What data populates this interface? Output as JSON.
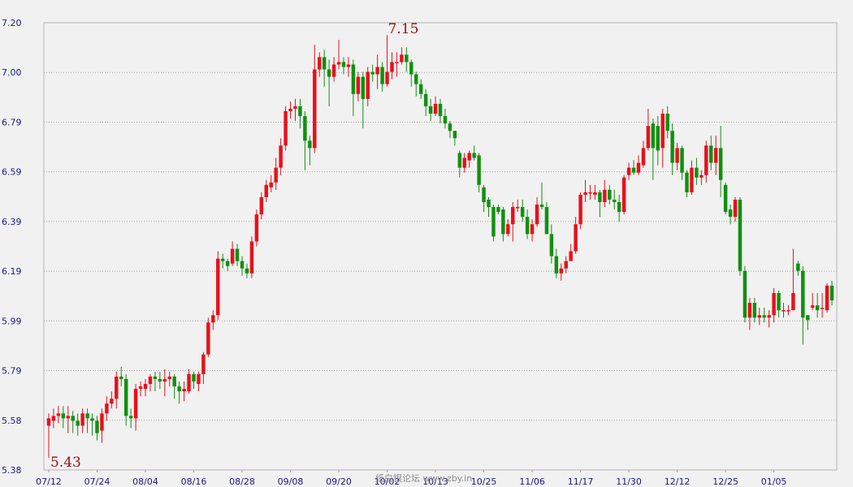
{
  "chart_data": {
    "type": "candlestick",
    "title": "",
    "xlabel": "",
    "ylabel": "",
    "ylim": [
      5.38,
      7.2
    ],
    "grid": true,
    "colors": {
      "up": "#e8101a",
      "down": "#119010",
      "grid": "#a8a8a8",
      "axis_text": "#1a1a80",
      "annotation": "#a01010"
    },
    "y_ticks": [
      "7.20",
      "7.00",
      "6.79",
      "6.59",
      "6.39",
      "6.19",
      "5.99",
      "5.79",
      "5.58",
      "5.38"
    ],
    "x_tick_labels": [
      {
        "label": "07/12",
        "index": 0
      },
      {
        "label": "07/24",
        "index": 10
      },
      {
        "label": "08/04",
        "index": 20
      },
      {
        "label": "08/16",
        "index": 30
      },
      {
        "label": "08/28",
        "index": 40
      },
      {
        "label": "09/08",
        "index": 50
      },
      {
        "label": "09/20",
        "index": 60
      },
      {
        "label": "10/02",
        "index": 70
      },
      {
        "label": "10/13",
        "index": 80
      },
      {
        "label": "10/25",
        "index": 90
      },
      {
        "label": "11/06",
        "index": 100
      },
      {
        "label": "11/17",
        "index": 110
      },
      {
        "label": "11/30",
        "index": 120
      },
      {
        "label": "12/12",
        "index": 130
      },
      {
        "label": "12/25",
        "index": 140
      },
      {
        "label": "01/05",
        "index": 150
      }
    ],
    "annotations": [
      {
        "text": "7.15",
        "index": 70,
        "value": 7.15,
        "kind": "max"
      },
      {
        "text": "5.43",
        "index": 0,
        "value": 5.43,
        "kind": "min"
      }
    ],
    "candles": [
      [
        5.56,
        5.59,
        5.61,
        5.43
      ],
      [
        5.58,
        5.6,
        5.63,
        5.55
      ],
      [
        5.6,
        5.61,
        5.64,
        5.57
      ],
      [
        5.61,
        5.59,
        5.64,
        5.55
      ],
      [
        5.59,
        5.6,
        5.64,
        5.53
      ],
      [
        5.6,
        5.58,
        5.62,
        5.53
      ],
      [
        5.58,
        5.56,
        5.61,
        5.52
      ],
      [
        5.56,
        5.61,
        5.63,
        5.53
      ],
      [
        5.61,
        5.59,
        5.63,
        5.53
      ],
      [
        5.59,
        5.58,
        5.61,
        5.52
      ],
      [
        5.58,
        5.53,
        5.6,
        5.5
      ],
      [
        5.54,
        5.61,
        5.63,
        5.49
      ],
      [
        5.61,
        5.65,
        5.68,
        5.58
      ],
      [
        5.65,
        5.67,
        5.7,
        5.63
      ],
      [
        5.67,
        5.76,
        5.78,
        5.63
      ],
      [
        5.76,
        5.75,
        5.8,
        5.72
      ],
      [
        5.75,
        5.6,
        5.77,
        5.56
      ],
      [
        5.6,
        5.59,
        5.63,
        5.55
      ],
      [
        5.59,
        5.71,
        5.73,
        5.54
      ],
      [
        5.71,
        5.72,
        5.74,
        5.68
      ],
      [
        5.71,
        5.73,
        5.75,
        5.68
      ],
      [
        5.73,
        5.76,
        5.77,
        5.7
      ],
      [
        5.76,
        5.75,
        5.78,
        5.7
      ],
      [
        5.75,
        5.74,
        5.78,
        5.71
      ],
      [
        5.74,
        5.75,
        5.79,
        5.68
      ],
      [
        5.75,
        5.76,
        5.78,
        5.72
      ],
      [
        5.76,
        5.72,
        5.77,
        5.67
      ],
      [
        5.72,
        5.7,
        5.74,
        5.65
      ],
      [
        5.7,
        5.71,
        5.74,
        5.66
      ],
      [
        5.7,
        5.77,
        5.79,
        5.69
      ],
      [
        5.77,
        5.74,
        5.78,
        5.71
      ],
      [
        5.73,
        5.77,
        5.78,
        5.7
      ],
      [
        5.77,
        5.85,
        5.86,
        5.73
      ],
      [
        5.85,
        5.98,
        6.0,
        5.84
      ],
      [
        5.98,
        6.01,
        6.03,
        5.95
      ],
      [
        6.01,
        6.24,
        6.27,
        5.99
      ],
      [
        6.24,
        6.23,
        6.26,
        6.2
      ],
      [
        6.23,
        6.21,
        6.24,
        6.19
      ],
      [
        6.22,
        6.28,
        6.31,
        6.21
      ],
      [
        6.28,
        6.23,
        6.3,
        6.21
      ],
      [
        6.23,
        6.2,
        6.25,
        6.17
      ],
      [
        6.2,
        6.18,
        6.22,
        6.16
      ],
      [
        6.18,
        6.31,
        6.33,
        6.16
      ],
      [
        6.31,
        6.42,
        6.44,
        6.29
      ],
      [
        6.42,
        6.49,
        6.51,
        6.4
      ],
      [
        6.49,
        6.54,
        6.56,
        6.47
      ],
      [
        6.53,
        6.55,
        6.58,
        6.51
      ],
      [
        6.55,
        6.61,
        6.65,
        6.52
      ],
      [
        6.61,
        6.7,
        6.73,
        6.58
      ],
      [
        6.7,
        6.84,
        6.86,
        6.68
      ],
      [
        6.84,
        6.85,
        6.88,
        6.81
      ],
      [
        6.85,
        6.86,
        6.89,
        6.8
      ],
      [
        6.86,
        6.82,
        6.89,
        6.77
      ],
      [
        6.82,
        6.72,
        6.84,
        6.6
      ],
      [
        6.72,
        6.69,
        6.74,
        6.62
      ],
      [
        6.69,
        7.01,
        7.11,
        6.67
      ],
      [
        7.01,
        7.06,
        7.08,
        6.98
      ],
      [
        7.06,
        7.01,
        7.09,
        6.94
      ],
      [
        7.01,
        6.98,
        7.05,
        6.86
      ],
      [
        6.98,
        7.03,
        7.06,
        6.96
      ],
      [
        7.03,
        7.04,
        7.13,
        7.01
      ],
      [
        7.04,
        7.02,
        7.06,
        6.99
      ],
      [
        7.02,
        7.03,
        7.06,
        6.98
      ],
      [
        7.03,
        6.91,
        7.05,
        6.82
      ],
      [
        6.91,
        6.98,
        7.0,
        6.88
      ],
      [
        6.98,
        6.89,
        7.0,
        6.77
      ],
      [
        6.89,
        7.0,
        7.02,
        6.86
      ],
      [
        7.0,
        6.99,
        7.03,
        6.96
      ],
      [
        6.99,
        7.02,
        7.07,
        6.93
      ],
      [
        7.02,
        6.95,
        7.04,
        6.92
      ],
      [
        6.95,
        7.0,
        7.15,
        6.94
      ],
      [
        7.0,
        7.04,
        7.08,
        6.97
      ],
      [
        7.04,
        7.04,
        7.08,
        6.98
      ],
      [
        7.04,
        7.07,
        7.1,
        7.03
      ],
      [
        7.07,
        7.04,
        7.1,
        7.0
      ],
      [
        7.04,
        6.99,
        7.05,
        6.94
      ],
      [
        6.99,
        6.95,
        7.0,
        6.9
      ],
      [
        6.95,
        6.91,
        6.97,
        6.89
      ],
      [
        6.91,
        6.86,
        6.93,
        6.82
      ],
      [
        6.86,
        6.83,
        6.89,
        6.8
      ],
      [
        6.83,
        6.87,
        6.9,
        6.82
      ],
      [
        6.87,
        6.82,
        6.89,
        6.79
      ],
      [
        6.82,
        6.79,
        6.85,
        6.77
      ],
      [
        6.79,
        6.76,
        6.8,
        6.73
      ],
      [
        6.76,
        6.73,
        6.76,
        6.7
      ],
      [
        6.67,
        6.61,
        6.68,
        6.57
      ],
      [
        6.61,
        6.65,
        6.67,
        6.59
      ],
      [
        6.64,
        6.67,
        6.68,
        6.61
      ],
      [
        6.67,
        6.65,
        6.7,
        6.64
      ],
      [
        6.66,
        6.54,
        6.67,
        6.51
      ],
      [
        6.53,
        6.47,
        6.54,
        6.43
      ],
      [
        6.48,
        6.45,
        6.49,
        6.41
      ],
      [
        6.45,
        6.33,
        6.46,
        6.31
      ],
      [
        6.45,
        6.43,
        6.46,
        6.42
      ],
      [
        6.44,
        6.34,
        6.45,
        6.31
      ],
      [
        6.34,
        6.38,
        6.4,
        6.33
      ],
      [
        6.38,
        6.45,
        6.47,
        6.31
      ],
      [
        6.45,
        6.45,
        6.48,
        6.43
      ],
      [
        6.45,
        6.41,
        6.48,
        6.39
      ],
      [
        6.41,
        6.34,
        6.44,
        6.32
      ],
      [
        6.34,
        6.38,
        6.4,
        6.31
      ],
      [
        6.38,
        6.46,
        6.49,
        6.37
      ],
      [
        6.46,
        6.45,
        6.55,
        6.44
      ],
      [
        6.45,
        6.34,
        6.47,
        6.34
      ],
      [
        6.34,
        6.25,
        6.38,
        6.22
      ],
      [
        6.25,
        6.18,
        6.28,
        6.16
      ],
      [
        6.18,
        6.2,
        6.22,
        6.15
      ],
      [
        6.2,
        6.23,
        6.25,
        6.18
      ],
      [
        6.23,
        6.27,
        6.3,
        6.25
      ],
      [
        6.27,
        6.38,
        6.41,
        6.26
      ],
      [
        6.38,
        6.5,
        6.51,
        6.36
      ],
      [
        6.5,
        6.51,
        6.56,
        6.47
      ],
      [
        6.51,
        6.51,
        6.54,
        6.48
      ],
      [
        6.5,
        6.51,
        6.54,
        6.48
      ],
      [
        6.51,
        6.47,
        6.52,
        6.41
      ],
      [
        6.47,
        6.52,
        6.56,
        6.45
      ],
      [
        6.52,
        6.48,
        6.54,
        6.46
      ],
      [
        6.48,
        6.47,
        6.52,
        6.44
      ],
      [
        6.47,
        6.43,
        6.5,
        6.39
      ],
      [
        6.43,
        6.57,
        6.58,
        6.42
      ],
      [
        6.58,
        6.61,
        6.63,
        6.56
      ],
      [
        6.61,
        6.59,
        6.64,
        6.58
      ],
      [
        6.59,
        6.63,
        6.66,
        6.58
      ],
      [
        6.62,
        6.69,
        6.72,
        6.61
      ],
      [
        6.69,
        6.78,
        6.85,
        6.68
      ],
      [
        6.79,
        6.69,
        6.81,
        6.56
      ],
      [
        6.78,
        6.68,
        6.82,
        6.62
      ],
      [
        6.69,
        6.83,
        6.85,
        6.61
      ],
      [
        6.83,
        6.76,
        6.86,
        6.73
      ],
      [
        6.76,
        6.63,
        6.79,
        6.58
      ],
      [
        6.63,
        6.69,
        6.71,
        6.6
      ],
      [
        6.69,
        6.59,
        6.7,
        6.56
      ],
      [
        6.59,
        6.51,
        6.6,
        6.49
      ],
      [
        6.51,
        6.61,
        6.64,
        6.5
      ],
      [
        6.61,
        6.57,
        6.65,
        6.54
      ],
      [
        6.57,
        6.58,
        6.6,
        6.54
      ],
      [
        6.58,
        6.7,
        6.72,
        6.55
      ],
      [
        6.7,
        6.63,
        6.74,
        6.6
      ],
      [
        6.63,
        6.69,
        6.74,
        6.58
      ],
      [
        6.69,
        6.56,
        6.78,
        6.49
      ],
      [
        6.54,
        6.43,
        6.55,
        6.42
      ],
      [
        6.44,
        6.41,
        6.46,
        6.38
      ],
      [
        6.41,
        6.48,
        6.49,
        6.39
      ],
      [
        6.48,
        6.19,
        6.49,
        6.17
      ],
      [
        6.19,
        6.0,
        6.21,
        5.98
      ],
      [
        6.0,
        6.06,
        6.08,
        5.95
      ],
      [
        6.06,
        6.0,
        6.08,
        5.98
      ],
      [
        6.0,
        6.01,
        6.04,
        5.97
      ],
      [
        6.01,
        6.0,
        6.04,
        5.98
      ],
      [
        6.0,
        6.01,
        6.03,
        5.96
      ],
      [
        6.01,
        6.1,
        6.12,
        5.98
      ],
      [
        6.1,
        6.03,
        6.11,
        6.0
      ],
      [
        6.03,
        6.03,
        6.06,
        6.0
      ],
      [
        6.03,
        6.03,
        6.05,
        6.01
      ],
      [
        6.03,
        6.1,
        6.28,
        6.09
      ],
      [
        6.22,
        6.19,
        6.23,
        6.17
      ],
      [
        6.19,
        6.0,
        6.21,
        5.89
      ],
      [
        6.01,
        5.99,
        6.01,
        5.95
      ],
      [
        6.04,
        6.05,
        6.1,
        6.03
      ],
      [
        6.05,
        6.03,
        6.1,
        6.0
      ],
      [
        6.04,
        6.04,
        6.1,
        6.0
      ],
      [
        6.03,
        6.13,
        6.14,
        6.02
      ],
      [
        6.13,
        6.07,
        6.15,
        6.05
      ]
    ]
  },
  "watermark": "纸白银论坛 www.zby.in"
}
